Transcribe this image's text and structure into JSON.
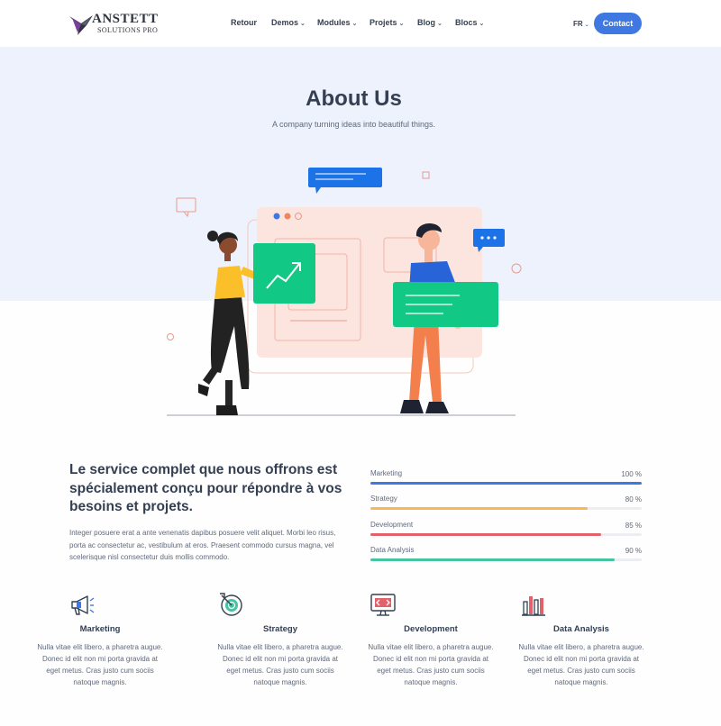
{
  "brand": {
    "name": "ANSTETT",
    "tagline": "SOLUTIONS PRO"
  },
  "nav": {
    "items": [
      {
        "label": "Retour",
        "has_dropdown": false
      },
      {
        "label": "Demos",
        "has_dropdown": true
      },
      {
        "label": "Modules",
        "has_dropdown": true
      },
      {
        "label": "Projets",
        "has_dropdown": true
      },
      {
        "label": "Blog",
        "has_dropdown": true
      },
      {
        "label": "Blocs",
        "has_dropdown": true
      }
    ],
    "language": "FR",
    "contact_label": "Contact"
  },
  "hero": {
    "title": "About Us",
    "subtitle": "A company turning ideas into beautiful things."
  },
  "about": {
    "headline": "Le service complet que nous offrons est spécialement conçu pour répondre à vos besoins et projets.",
    "paragraph": "Integer posuere erat a ante venenatis dapibus posuere velit aliquet. Morbi leo risus, porta ac consectetur ac, vestibulum at eros. Praesent commodo cursus magna, vel scelerisque nisl consectetur duis mollis commodo."
  },
  "skills": [
    {
      "label": "Marketing",
      "percent_label": "100 %",
      "value": 100,
      "color": "#3f78e0"
    },
    {
      "label": "Strategy",
      "percent_label": "80 %",
      "value": 80,
      "color": "#fab758"
    },
    {
      "label": "Development",
      "percent_label": "85 %",
      "value": 85,
      "color": "#e2626b"
    },
    {
      "label": "Data Analysis",
      "percent_label": "90 %",
      "value": 90,
      "color": "#45c4a0"
    }
  ],
  "features": [
    {
      "title": "Marketing",
      "icon": "megaphone-icon",
      "text": "Nulla vitae elit libero, a pharetra augue. Donec id elit non mi porta gravida at eget metus. Cras justo cum sociis natoque magnis."
    },
    {
      "title": "Strategy",
      "icon": "target-icon",
      "text": "Nulla vitae elit libero, a pharetra augue. Donec id elit non mi porta gravida at eget metus. Cras justo cum sociis natoque magnis."
    },
    {
      "title": "Development",
      "icon": "monitor-code-icon",
      "text": "Nulla vitae elit libero, a pharetra augue. Donec id elit non mi porta gravida at eget metus. Cras justo cum sociis natoque magnis."
    },
    {
      "title": "Data Analysis",
      "icon": "bar-chart-icon",
      "text": "Nulla vitae elit libero, a pharetra augue. Donec id elit non mi porta gravida at eget metus. Cras justo cum sociis natoque magnis."
    }
  ],
  "colors": {
    "primary": "#3f78e0",
    "hero_bg": "#edf2fc",
    "heading": "#343f52",
    "body_text": "#60697b"
  }
}
